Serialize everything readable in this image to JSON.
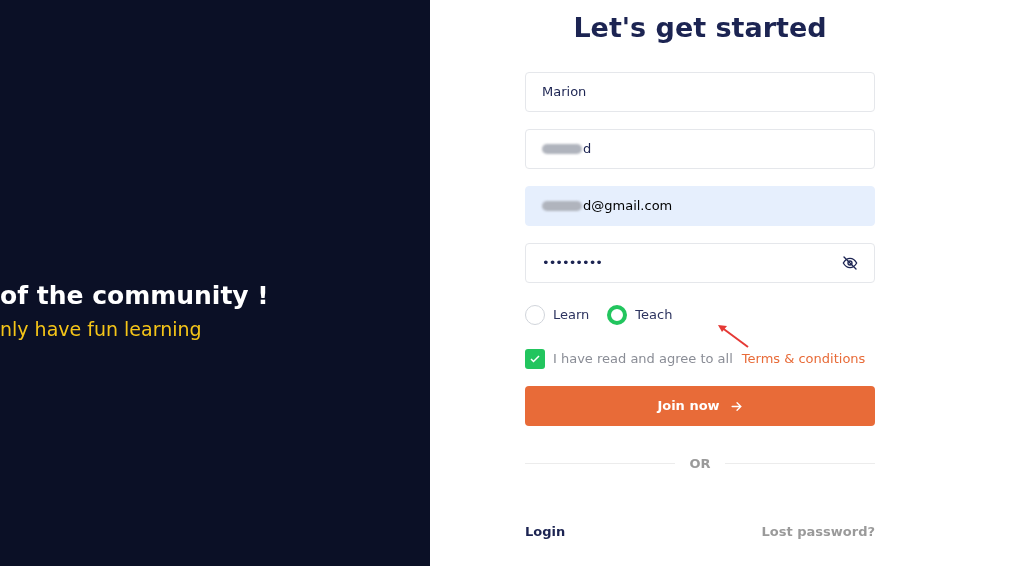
{
  "hero": {
    "headline": "of the community !",
    "tagline": "nly have fun learning"
  },
  "form": {
    "title": "Let's get started",
    "fields": [
      {
        "kind": "text",
        "value": "Marion",
        "autofilled": false,
        "redacted": false
      },
      {
        "kind": "text",
        "value": "d",
        "autofilled": false,
        "redacted": true
      },
      {
        "kind": "text",
        "value": "d@gmail.com",
        "autofilled": true,
        "redacted": true
      },
      {
        "kind": "password",
        "value": "•••••••••",
        "autofilled": false,
        "redacted": false
      }
    ],
    "roles": [
      {
        "label": "Learn",
        "selected": false
      },
      {
        "label": "Teach",
        "selected": true
      }
    ],
    "agree": {
      "checked": true,
      "text": "I have read and agree to all",
      "link": "Terms & conditions"
    },
    "submit": "Join now",
    "divider": "OR",
    "login": "Login",
    "lost_password": "Lost password?"
  }
}
